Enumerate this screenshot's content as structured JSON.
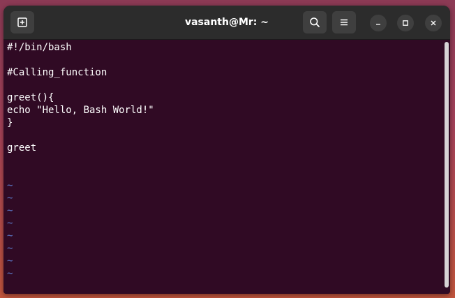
{
  "window": {
    "title": "vasanth@Mr: ~"
  },
  "icons": {
    "new_tab": "new-tab-icon",
    "search": "search-icon",
    "menu": "hamburger-menu-icon",
    "minimize": "minimize-icon",
    "maximize": "maximize-icon",
    "close": "close-icon"
  },
  "editor": {
    "lines": [
      "#!/bin/bash",
      "",
      "#Calling_function",
      "",
      "greet(){",
      "echo \"Hello, Bash World!\"",
      "}",
      "",
      "greet"
    ],
    "tilde": "~",
    "tilde_count": 8
  },
  "colors": {
    "terminal_bg": "#300a24",
    "titlebar_bg": "#2c2c2c",
    "tilde": "#5c78c8",
    "text": "#ffffff"
  }
}
